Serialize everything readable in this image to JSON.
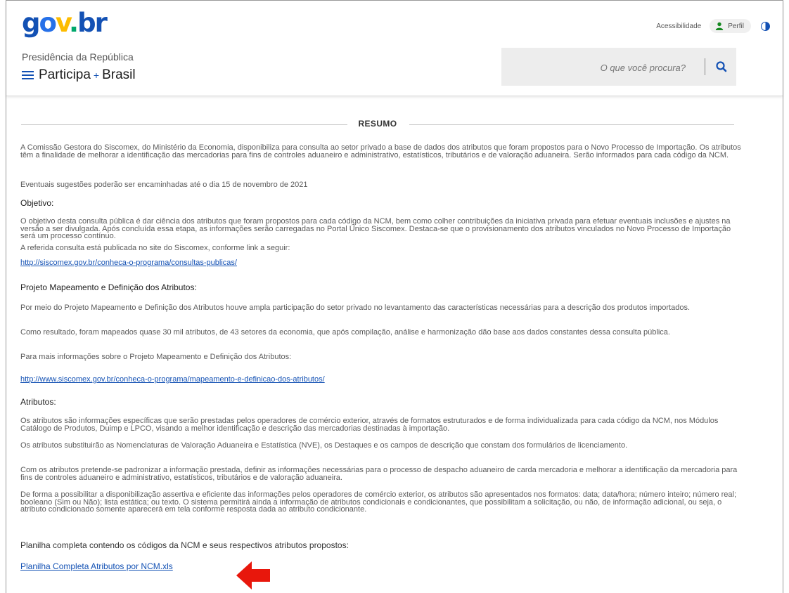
{
  "header": {
    "logo": {
      "g": "g",
      "o": "o",
      "v": "v",
      "dot": ".",
      "br": "br"
    },
    "org_name": "Presidência da República",
    "site_name_a": "Participa",
    "site_plus": "+",
    "site_name_b": "Brasil",
    "accessibility_label": "Acessibilidade",
    "profile_label": "Perfil",
    "search_placeholder": "O que você procura?"
  },
  "section": {
    "title": "RESUMO"
  },
  "body": {
    "intro": "A Comissão Gestora do Siscomex, do Ministério da Economia, disponibiliza para consulta ao setor privado a base de dados dos atributos que foram propostos para o Novo Processo de Importação. Os atributos têm a finalidade de melhorar a identificação das mercadorias para fins de controles aduaneiro e administrativo, estatísticos, tributários e de valoração aduaneira. Serão informados para cada código da NCM.",
    "deadline": "Eventuais sugestões poderão ser encaminhadas até o dia 15 de novembro de 2021",
    "objective_heading": "Objetivo:",
    "objective_text": "O objetivo desta consulta pública é dar ciência dos atributos que foram propostos para cada código da NCM, bem como colher contribuições da iniciativa privada para efetuar eventuais inclusões e ajustes na versão a ser divulgada. Após concluída essa etapa, as informações serão carregadas no Portal Único Siscomex. Destaca-se que o provisionamento dos atributos vinculados no Novo Processo de Importação será um processo contínuo.",
    "objective_link_text": "A referida consulta está publicada no site do Siscomex, conforme link a seguir:",
    "link1": "http://siscomex.gov.br/conheca-o-programa/consultas-publicas/",
    "project_heading": "Projeto Mapeamento e Definição dos Atributos:",
    "project_p1": "Por meio do Projeto Mapeamento e Definição dos Atributos houve ampla participação do setor privado no levantamento das características necessárias para a descrição dos produtos importados.",
    "project_p2": "Como resultado, foram mapeados quase 30 mil atributos, de 43 setores da economia, que após compilação, análise e harmonização dão base aos dados constantes dessa consulta pública.",
    "project_p3": "Para mais informações sobre o Projeto Mapeamento e Definição dos Atributos:",
    "link2": "http://www.siscomex.gov.br/conheca-o-programa/mapeamento-e-definicao-dos-atributos/",
    "attributes_heading": "Atributos:",
    "attr_p1": "Os atributos são informações específicas que serão prestadas pelos operadores de comércio exterior, através de formatos estruturados e de forma individualizada para cada código da NCM, nos Módulos Catálogo de Produtos, Duimp e LPCO, visando a melhor identificação e descrição das mercadorias destinadas à importação.",
    "attr_p2": "Os atributos substituirão as Nomenclaturas de Valoração Aduaneira e Estatística (NVE), os Destaques e os campos de descrição que constam dos formulários de licenciamento.",
    "attr_p3": "Com os atributos pretende-se padronizar a informação prestada, definir as informações necessárias para o processo de despacho aduaneiro de carda mercadoria e melhorar a identificação da mercadoria para fins de controles aduaneiro e administrativo, estatísticos, tributários e de valoração aduaneira.",
    "attr_p4": "De forma a possibilitar a disponibilização assertiva e eficiente das informações pelos operadores de comércio exterior, os atributos são apresentados nos formatos: data; data/hora; número inteiro; número real; booleano (Sim ou Não); lista estática; ou texto. O sistema permitirá ainda a informação de atributos condicionais e condicionantes, que possibilitam a solicitação, ou não, de informação adicional, ou seja, o atributo condicionado somente aparecerá em tela conforme resposta dada ao atributo condicionante.",
    "spreadsheet_heading": "Planilha completa contendo os códigos da NCM e seus respectivos atributos propostos:",
    "spreadsheet_link": "Planilha Completa Atributos por NCM.xls"
  },
  "colors": {
    "brand_blue": "#1351b4",
    "brand_yellow": "#fdbc00",
    "brand_green": "#00a86b",
    "arrow_red": "#e8170c"
  }
}
